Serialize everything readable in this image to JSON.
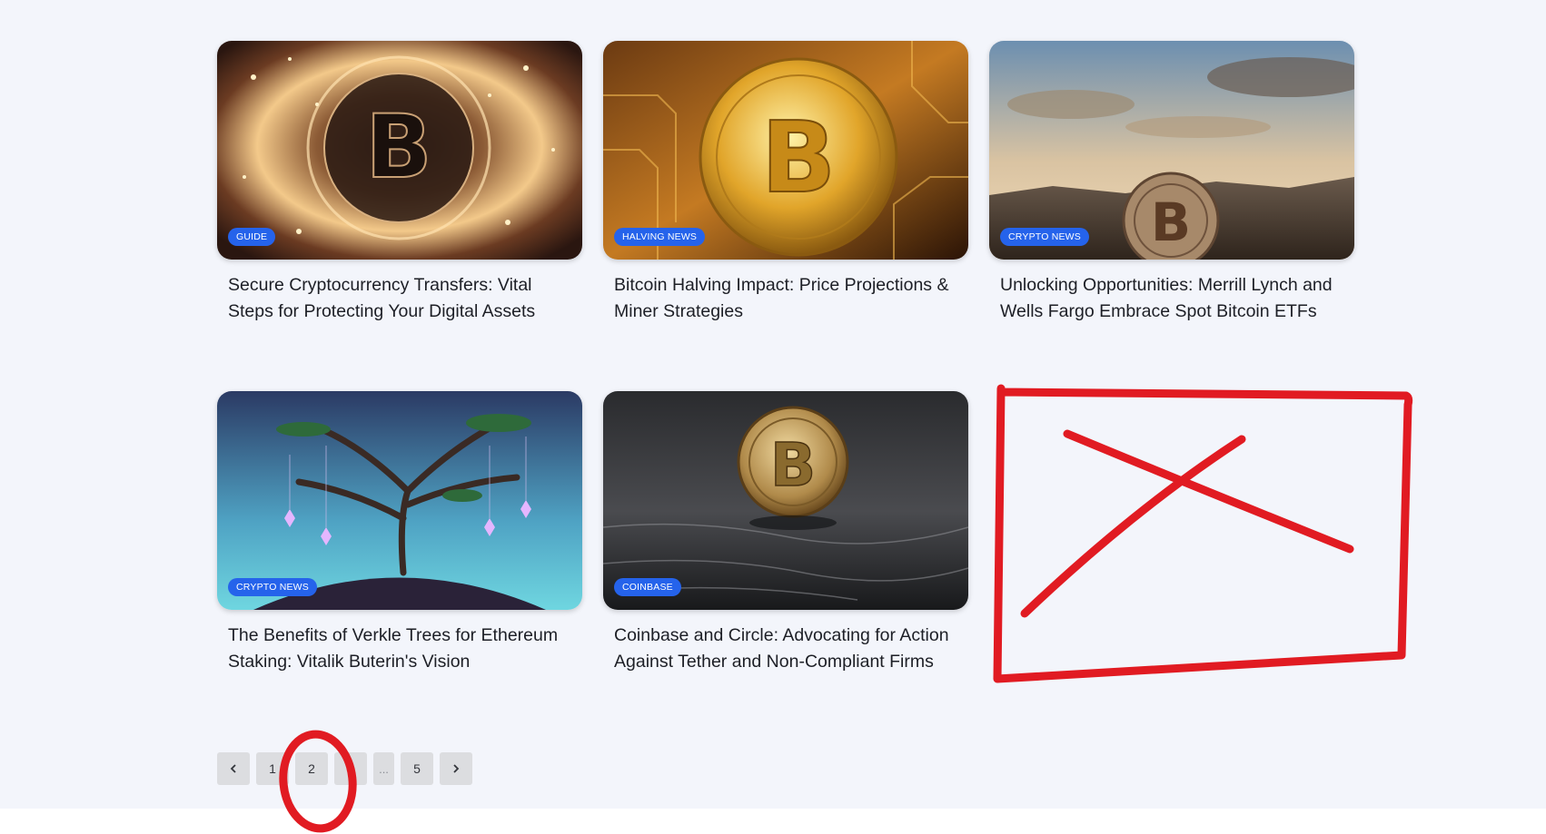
{
  "articles": [
    {
      "title": "Secure Cryptocurrency Transfers: Vital Steps for Protecting Your Digital Assets",
      "badge": "GUIDE",
      "image": "bitcoin-sparks-image"
    },
    {
      "title": "Bitcoin Halving Impact: Price Projections & Miner Strategies",
      "badge": "HALVING NEWS",
      "image": "bitcoin-circuit-image"
    },
    {
      "title": "Unlocking Opportunities: Merrill Lynch and Wells Fargo Embrace Spot Bitcoin ETFs",
      "badge": "CRYPTO NEWS",
      "image": "bitcoin-desert-image"
    },
    {
      "title": "The Benefits of Verkle Trees for Ethereum Staking: Vitalik Buterin's Vision",
      "badge": "CRYPTO NEWS",
      "image": "verkle-tree-image"
    },
    {
      "title": "Coinbase and Circle: Advocating for Action Against Tether and Non-Compliant Firms",
      "badge": "COINBASE",
      "image": "bitcoin-stone-image"
    }
  ],
  "pagination": {
    "prev_icon": "chevron-left-icon",
    "pages": [
      "1",
      "2",
      "3",
      "5"
    ],
    "ellipsis": "...",
    "next_icon": "chevron-right-icon",
    "current": "2"
  },
  "colors": {
    "background": "#f3f5fb",
    "badge": "#2563eb",
    "annotation": "#e11b22"
  }
}
